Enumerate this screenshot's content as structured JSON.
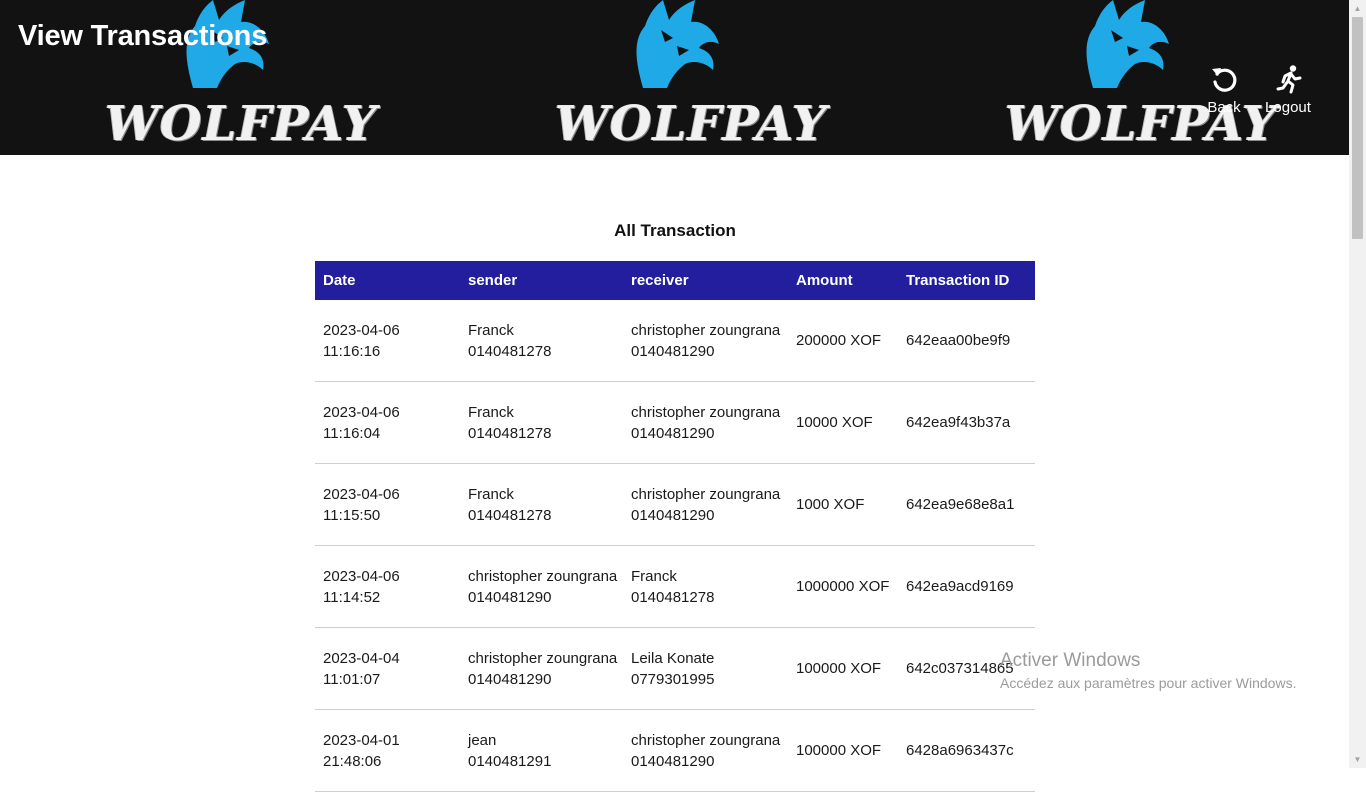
{
  "header": {
    "title": "View Transactions",
    "brand": "WOLFPAY",
    "nav": {
      "back_label": "Back",
      "logout_label": "Logout"
    }
  },
  "main": {
    "section_title": "All Transaction",
    "columns": [
      "Date",
      "sender",
      "receiver",
      "Amount",
      "Transaction ID"
    ],
    "rows": [
      {
        "date": "2023-04-06",
        "time": "11:16:16",
        "sender_name": "Franck",
        "sender_phone": "0140481278",
        "receiver_name": "christopher zoungrana",
        "receiver_phone": "0140481290",
        "amount": "200000 XOF",
        "tx_id": "642eaa00be9f9"
      },
      {
        "date": "2023-04-06",
        "time": "11:16:04",
        "sender_name": "Franck",
        "sender_phone": "0140481278",
        "receiver_name": "christopher zoungrana",
        "receiver_phone": "0140481290",
        "amount": "10000 XOF",
        "tx_id": "642ea9f43b37a"
      },
      {
        "date": "2023-04-06",
        "time": "11:15:50",
        "sender_name": "Franck",
        "sender_phone": "0140481278",
        "receiver_name": "christopher zoungrana",
        "receiver_phone": "0140481290",
        "amount": "1000 XOF",
        "tx_id": "642ea9e68e8a1"
      },
      {
        "date": "2023-04-06",
        "time": "11:14:52",
        "sender_name": "christopher zoungrana",
        "sender_phone": "0140481290",
        "receiver_name": "Franck",
        "receiver_phone": "0140481278",
        "amount": "1000000 XOF",
        "tx_id": "642ea9acd9169"
      },
      {
        "date": "2023-04-04",
        "time": "11:01:07",
        "sender_name": "christopher zoungrana",
        "sender_phone": "0140481290",
        "receiver_name": "Leila Konate",
        "receiver_phone": "0779301995",
        "amount": "100000 XOF",
        "tx_id": "642c037314865"
      },
      {
        "date": "2023-04-01",
        "time": "21:48:06",
        "sender_name": "jean",
        "sender_phone": "0140481291",
        "receiver_name": "christopher zoungrana",
        "receiver_phone": "0140481290",
        "amount": "100000 XOF",
        "tx_id": "6428a6963437c"
      }
    ]
  },
  "watermark": {
    "title": "Activer Windows",
    "subtitle": "Accédez aux paramètres pour activer Windows."
  },
  "colors": {
    "header_bg": "#121212",
    "table_header_bg": "#221e9e",
    "wolf_accent": "#1fa9e6"
  },
  "icons": {
    "back": "undo-arrow-icon",
    "logout": "running-person-icon",
    "logo": "howling-wolf-icon"
  }
}
